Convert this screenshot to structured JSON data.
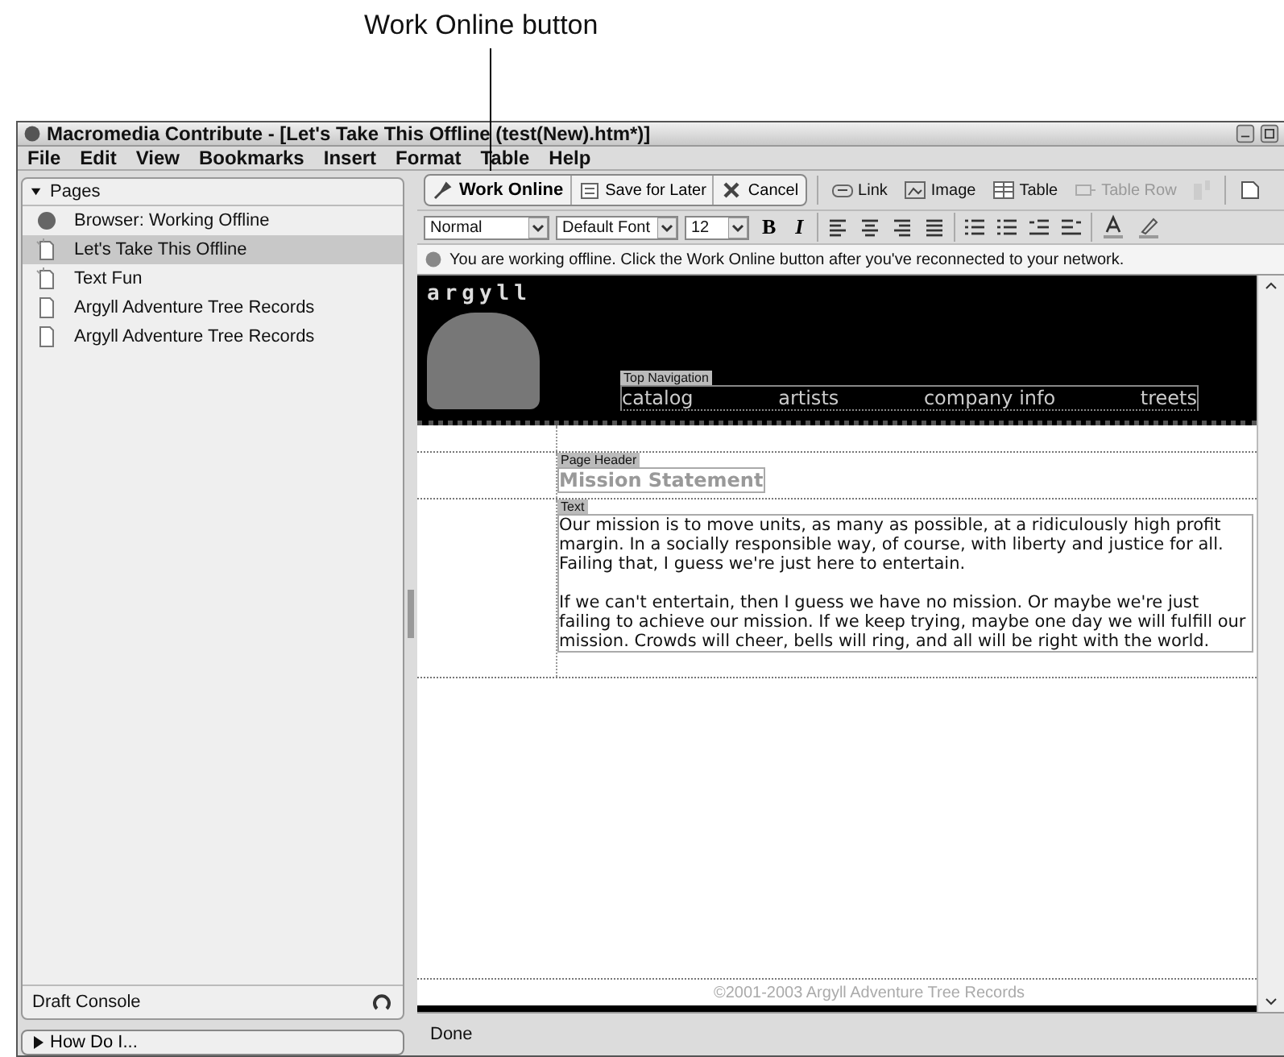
{
  "callout": {
    "label": "Work Online button"
  },
  "window": {
    "title": "Macromedia Contribute - [Let's Take This Offline (test(New).htm*)]"
  },
  "menu": [
    "File",
    "Edit",
    "View",
    "Bookmarks",
    "Insert",
    "Format",
    "Table",
    "Help"
  ],
  "pages_panel": {
    "title": "Pages",
    "expanded": true,
    "items": [
      {
        "label": "Browser: Working Offline",
        "kind": "browser",
        "selected": false
      },
      {
        "label": "Let's Take This Offline",
        "kind": "draft",
        "selected": true
      },
      {
        "label": "Text Fun",
        "kind": "draft",
        "selected": false
      },
      {
        "label": "Argyll Adventure Tree Records",
        "kind": "page",
        "selected": false
      },
      {
        "label": "Argyll Adventure Tree Records",
        "kind": "page",
        "selected": false
      }
    ]
  },
  "draft_console": {
    "label": "Draft Console"
  },
  "how_do_i": {
    "label": "How Do I...",
    "expanded": false
  },
  "toolbar": {
    "main_buttons": [
      {
        "label": "Work Online",
        "kind": "plug",
        "bold": true
      },
      {
        "label": "Save for Later",
        "kind": "save",
        "bold": false
      },
      {
        "label": "Cancel",
        "kind": "cancel",
        "bold": false
      }
    ],
    "insert_buttons": [
      {
        "label": "Link",
        "kind": "link",
        "disabled": false
      },
      {
        "label": "Image",
        "kind": "image",
        "disabled": false
      },
      {
        "label": "Table",
        "kind": "table",
        "disabled": false
      },
      {
        "label": "Table Row",
        "kind": "row",
        "disabled": true
      }
    ]
  },
  "format_bar": {
    "style": "Normal",
    "font": "Default Font",
    "size": "12",
    "bold_label": "B",
    "italic_label": "I"
  },
  "info_bar": {
    "message": "You are working offline. Click the Work Online button after you've reconnected to your network."
  },
  "document": {
    "logo": "argyll",
    "nav_tag": "Top Navigation",
    "nav_links": [
      "catalog",
      "artists",
      "company info",
      "treets"
    ],
    "header_tag": "Page Header",
    "heading": "Mission Statement",
    "text_tag": "Text",
    "paragraphs": [
      "Our mission is to move units, as many as possible, at a ridiculously high profit margin. In a socially responsible way, of course, with liberty and justice for all. Failing that, I guess we're just here to entertain.",
      "If we can't entertain, then I guess we have no mission. Or maybe we're just failing to achieve our mission. If we keep trying, maybe one day we will fulfill our mission. Crowds will cheer, bells will ring, and all will be right with the world."
    ],
    "footer": "©2001-2003 Argyll Adventure Tree Records"
  },
  "status_bar": {
    "text": "Done"
  }
}
